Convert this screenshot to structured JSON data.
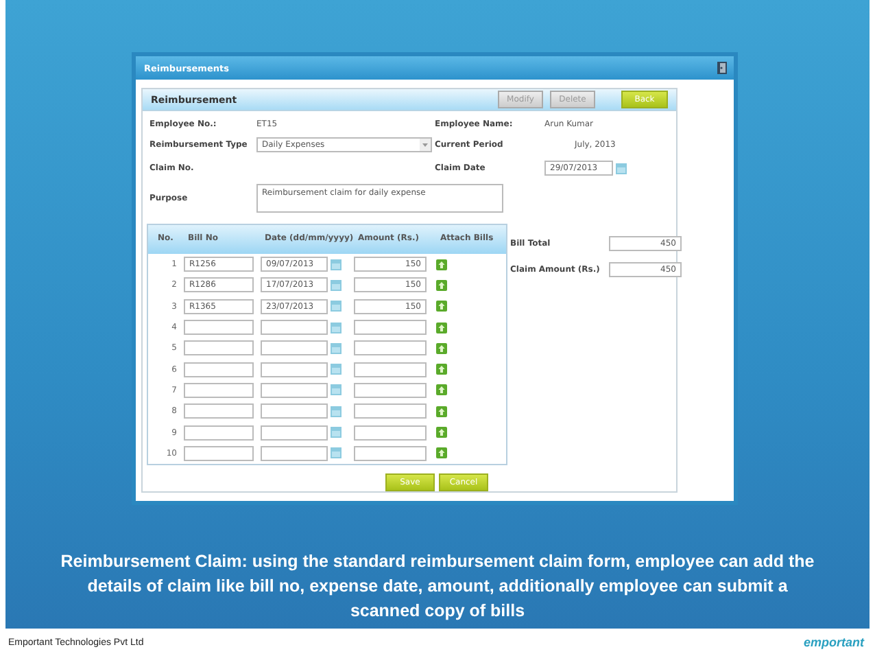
{
  "window": {
    "title": "Reimbursements"
  },
  "panel": {
    "title": "Reimbursement",
    "buttons": [
      {
        "label": "Modify",
        "disabled": true
      },
      {
        "label": "Delete",
        "disabled": true
      },
      {
        "label": "Back",
        "disabled": false
      }
    ]
  },
  "form": {
    "employee_no": {
      "label": "Employee No.:",
      "value": "ET15"
    },
    "employee_name": {
      "label": "Employee Name:",
      "value": "Arun Kumar"
    },
    "reimbursement_type": {
      "label": "Reimbursement Type",
      "value": "Daily Expenses"
    },
    "current_period": {
      "label": "Current Period",
      "value": "July, 2013"
    },
    "claim_no": {
      "label": "Claim No."
    },
    "claim_date": {
      "label": "Claim Date",
      "value": "29/07/2013"
    },
    "purpose": {
      "label": "Purpose",
      "value": "Reimbursement claim for daily expense"
    }
  },
  "table": {
    "columns": [
      "No.",
      "Bill No",
      "Date (dd/mm/yyyy)",
      "Amount (Rs.)",
      "Attach Bills"
    ],
    "rows": [
      {
        "no": "1",
        "bill_no": "R1256",
        "date": "09/07/2013",
        "amount": "150"
      },
      {
        "no": "2",
        "bill_no": "R1286",
        "date": "17/07/2013",
        "amount": "150"
      },
      {
        "no": "3",
        "bill_no": "R1365",
        "date": "23/07/2013",
        "amount": "150"
      },
      {
        "no": "4"
      },
      {
        "no": "5"
      },
      {
        "no": "6"
      },
      {
        "no": "7"
      },
      {
        "no": "8"
      },
      {
        "no": "9"
      },
      {
        "no": "10"
      }
    ]
  },
  "totals": [
    {
      "label": "Bill Total",
      "value": "450"
    },
    {
      "label": "Claim Amount (Rs.)",
      "value": "450"
    }
  ],
  "actions": [
    "Save",
    "Cancel"
  ],
  "caption": "Reimbursement Claim: using the standard reimbursement claim form, employee can add the details of claim like bill no, expense date, amount, additionally employee can submit a scanned copy of bills",
  "footer": {
    "company": "Emportant Technologies Pvt Ltd",
    "logo": "emportant"
  }
}
